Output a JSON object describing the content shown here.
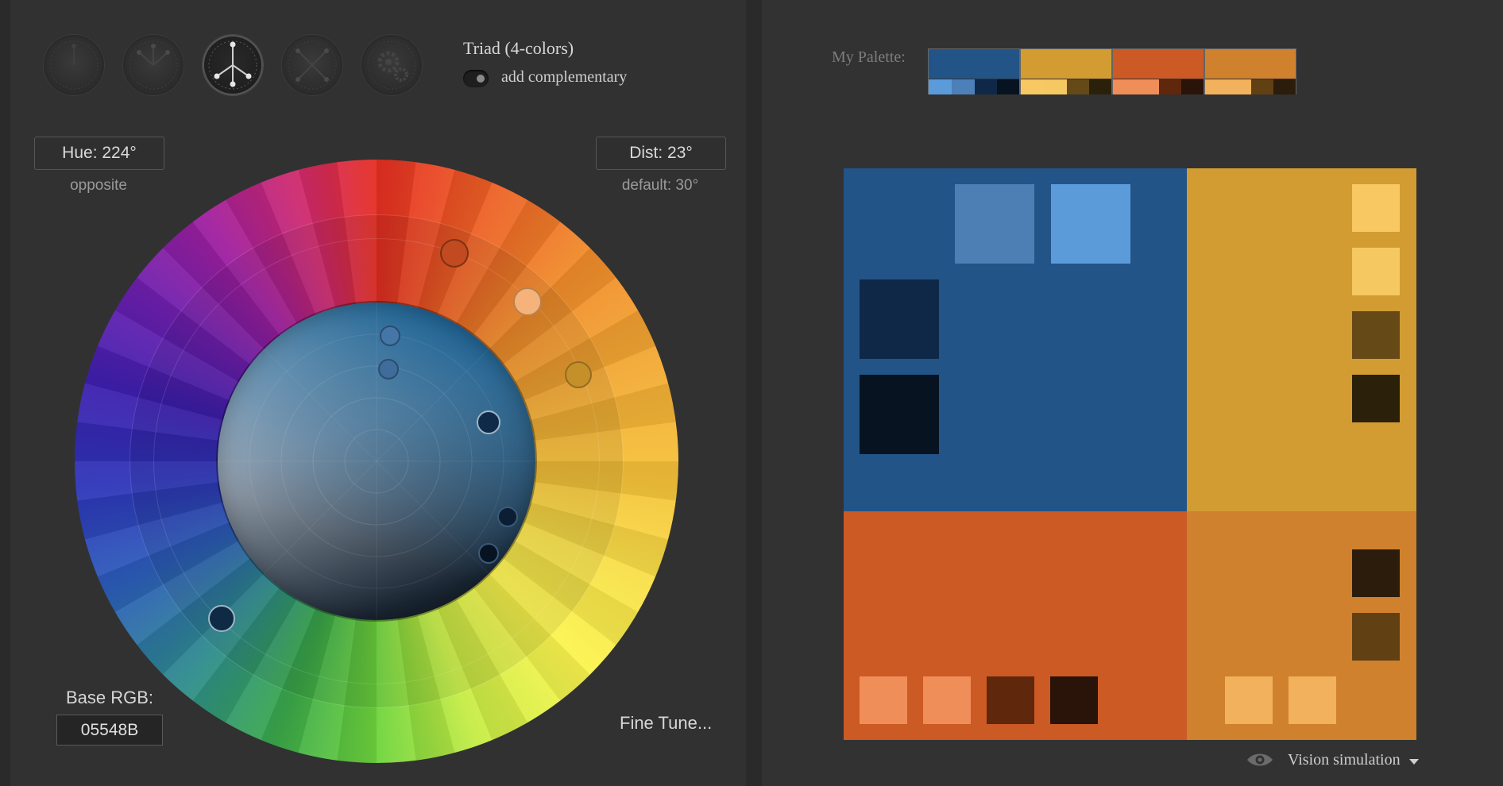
{
  "scheme": {
    "title": "Triad (4-colors)",
    "toggle_label": "add complementary",
    "toggle_on": false,
    "buttons": [
      {
        "name": "mono",
        "icon": "single-line-dial-icon",
        "active": false
      },
      {
        "name": "complement",
        "icon": "two-arms-dial-icon",
        "active": false
      },
      {
        "name": "triad",
        "icon": "triad-dial-icon",
        "active": true
      },
      {
        "name": "tetrad",
        "icon": "four-arms-dial-icon",
        "active": false
      },
      {
        "name": "free",
        "icon": "gear-icon",
        "active": false
      }
    ]
  },
  "hue": {
    "label": "Hue: 224°",
    "sub": "opposite"
  },
  "dist": {
    "label": "Dist: 23°",
    "sub": "default: 30°"
  },
  "base": {
    "label": "Base RGB:",
    "value": "05548B"
  },
  "fine_tune": "Fine Tune...",
  "palette": {
    "label": "My Palette:",
    "swatches": [
      {
        "main": "#225488",
        "subs": [
          "#5b9bd9",
          "#4d80b8",
          "#0f2848",
          "#071321"
        ]
      },
      {
        "main": "#d29c32",
        "subs": [
          "#f8c963",
          "#f6c862",
          "#654a17",
          "#2b200a"
        ]
      },
      {
        "main": "#cc5a24",
        "subs": [
          "#f08e59",
          "#f08e59",
          "#5f270b",
          "#2a1309"
        ]
      },
      {
        "main": "#cf812e",
        "subs": [
          "#f2b15c",
          "#f2b15c",
          "#614013",
          "#2c1c0b"
        ]
      }
    ]
  },
  "grid": {
    "blue": {
      "bg": "#225488",
      "swatches": [
        "#4d7fb5",
        "#5b9bd9",
        "#0f2848",
        "#071321"
      ]
    },
    "yellow": {
      "bg": "#d29c32",
      "swatches": [
        "#f8c963",
        "#f6c862",
        "#654a17",
        "#2b200a"
      ]
    },
    "orange": {
      "bg": "#cc5a24",
      "swatches": [
        "#f08e59",
        "#f08e59",
        "#5f270b",
        "#2a1309"
      ]
    },
    "amber": {
      "bg": "#cf812e",
      "swatches": [
        "#2c1c0b",
        "#614013",
        "#f2b15c",
        "#f2b15c"
      ]
    }
  },
  "vision": {
    "label": "Vision simulation",
    "icon": "eye-icon"
  }
}
